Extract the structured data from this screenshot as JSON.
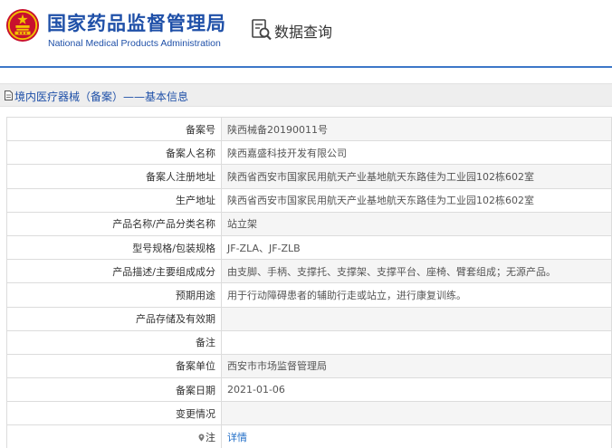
{
  "header": {
    "site_name": "国家药品监督管理局",
    "site_name_en": "National Medical Products Administration",
    "query_title": "数据查询",
    "accent_color": "#1f50a8"
  },
  "breadcrumb": {
    "text": "境内医疗器械（备案）——基本信息"
  },
  "detail": {
    "rows": [
      {
        "label": "备案号",
        "value": "陕西械备20190011号"
      },
      {
        "label": "备案人名称",
        "value": "陕西嘉盛科技开发有限公司"
      },
      {
        "label": "备案人注册地址",
        "value": "陕西省西安市国家民用航天产业基地航天东路佳为工业园102栋602室"
      },
      {
        "label": "生产地址",
        "value": "陕西省西安市国家民用航天产业基地航天东路佳为工业园102栋602室"
      },
      {
        "label": "产品名称/产品分类名称",
        "value": "站立架"
      },
      {
        "label": "型号规格/包装规格",
        "value": "JF-ZLA、JF-ZLB"
      },
      {
        "label": "产品描述/主要组成成分",
        "value": "由支脚、手柄、支撑托、支撑架、支撑平台、座椅、臂套组成；无源产品。"
      },
      {
        "label": "预期用途",
        "value": "用于行动障碍患者的辅助行走或站立，进行康复训练。"
      },
      {
        "label": "产品存储及有效期",
        "value": ""
      },
      {
        "label": "备注",
        "value": ""
      },
      {
        "label": "备案单位",
        "value": "西安市市场监督管理局"
      },
      {
        "label": "备案日期",
        "value": "2021-01-06"
      },
      {
        "label": "变更情况",
        "value": ""
      }
    ],
    "note_label": "注",
    "note_icon": "pin-icon",
    "note_link": "详情"
  }
}
